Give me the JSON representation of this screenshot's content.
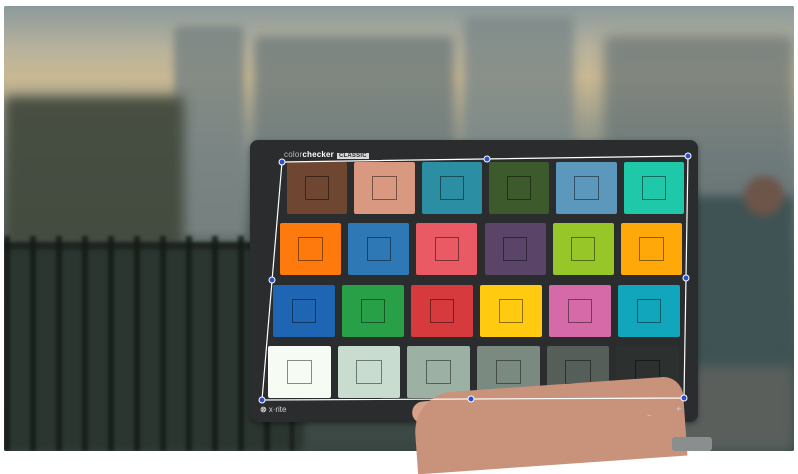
{
  "viewer": {
    "content": "colorchecker-calibration-frame"
  },
  "chart_card": {
    "brand_prefix": "color",
    "brand_main": "checker",
    "brand_tag": "CLASSIC",
    "maker_logo": "⊗",
    "maker": "x·rite",
    "plus_mark": "+",
    "minus_mark": "−"
  },
  "patches": [
    {
      "name": "patch-dark-skin",
      "color": "#6e4632"
    },
    {
      "name": "patch-light-skin",
      "color": "#d99880"
    },
    {
      "name": "patch-blue-sky",
      "color": "#2c8ea2"
    },
    {
      "name": "patch-foliage",
      "color": "#3c5a2c"
    },
    {
      "name": "patch-blue-flower",
      "color": "#5c98bc"
    },
    {
      "name": "patch-bluish-green",
      "color": "#1ec8a8"
    },
    {
      "name": "patch-orange",
      "color": "#ff7a0c"
    },
    {
      "name": "patch-purplish-blue",
      "color": "#2e78b6"
    },
    {
      "name": "patch-moderate-red",
      "color": "#ea5a64"
    },
    {
      "name": "patch-purple",
      "color": "#5a4468"
    },
    {
      "name": "patch-yellow-green",
      "color": "#96c628"
    },
    {
      "name": "patch-orange-yellow",
      "color": "#ffa80a"
    },
    {
      "name": "patch-blue",
      "color": "#1e66b4"
    },
    {
      "name": "patch-green",
      "color": "#28a048"
    },
    {
      "name": "patch-red",
      "color": "#d63a3c"
    },
    {
      "name": "patch-yellow",
      "color": "#ffca10"
    },
    {
      "name": "patch-magenta",
      "color": "#d66aa8"
    },
    {
      "name": "patch-cyan",
      "color": "#12a6bc"
    },
    {
      "name": "patch-white",
      "color": "#f6fbf4"
    },
    {
      "name": "patch-neutral-8",
      "color": "#c8ddd0"
    },
    {
      "name": "patch-neutral-6-5",
      "color": "#9db0a4"
    },
    {
      "name": "patch-neutral-5",
      "color": "#7b8a80"
    },
    {
      "name": "patch-neutral-3-5",
      "color": "#555e58"
    },
    {
      "name": "patch-black",
      "color": "#2c302e"
    }
  ],
  "overlay": {
    "grid_color": "#ffffff",
    "handle_color": "#2a4fcf"
  }
}
